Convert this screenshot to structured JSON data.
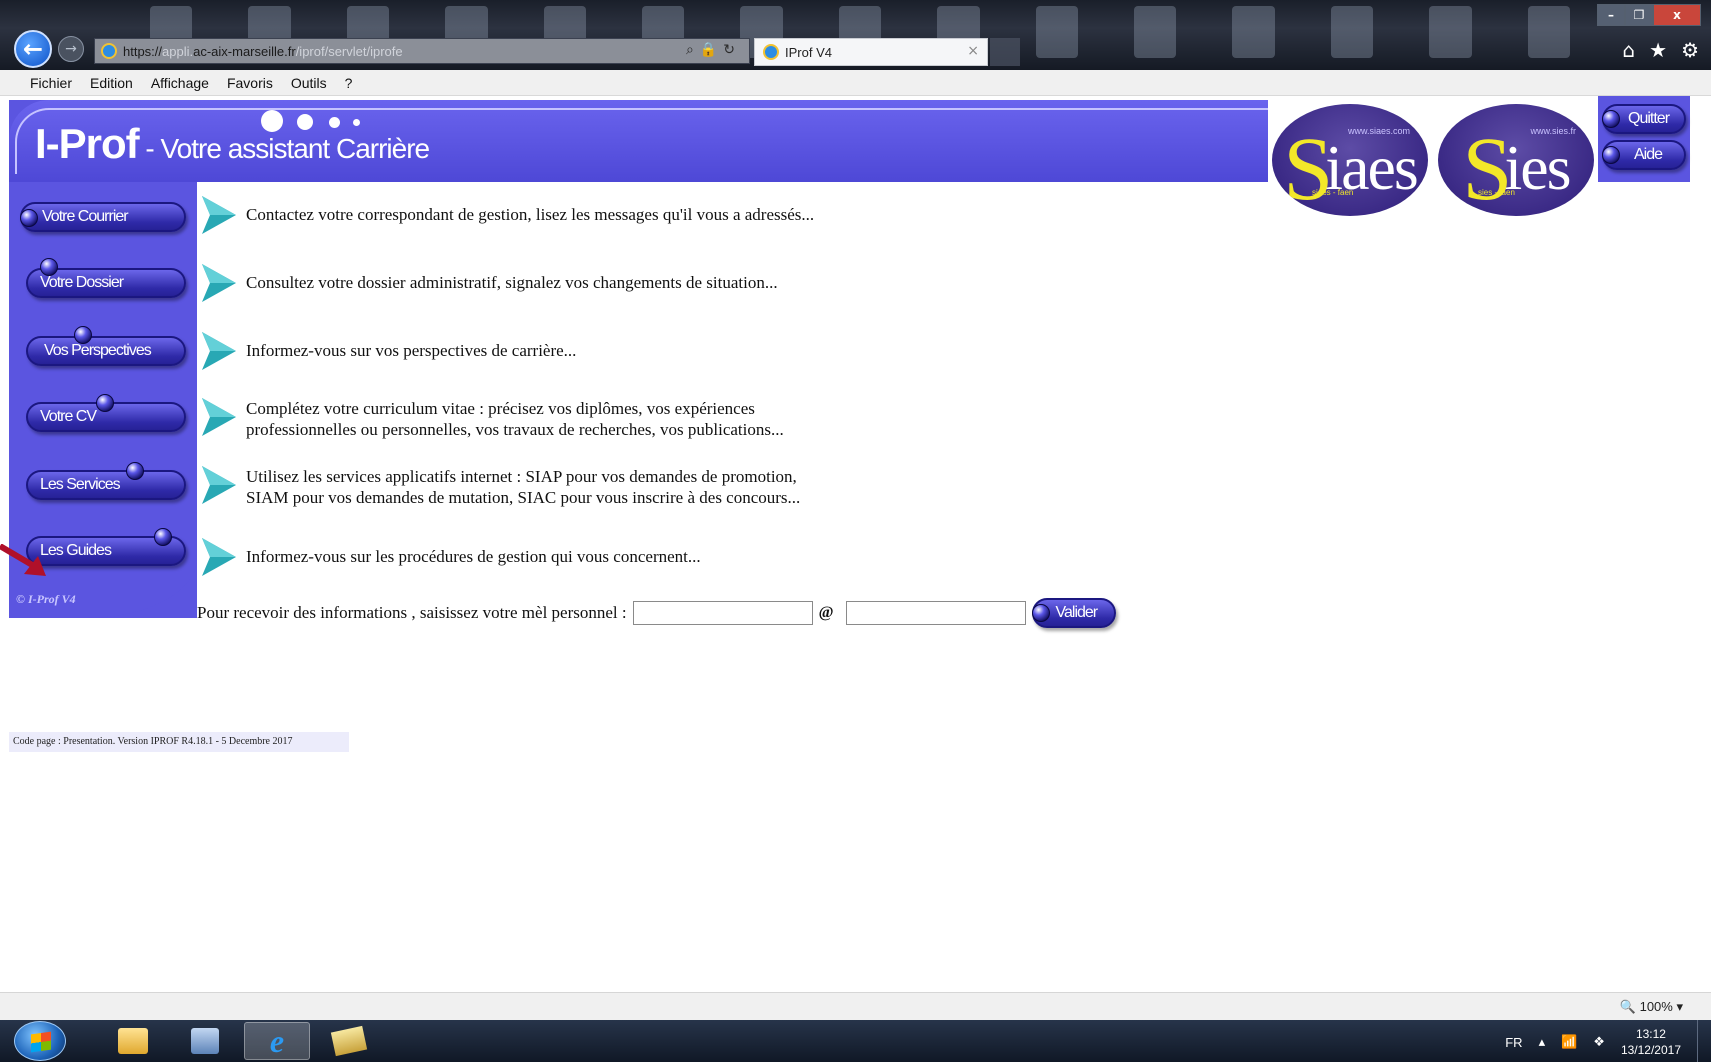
{
  "browser": {
    "url_host_prefix": "https://",
    "url_gray1": "appli.",
    "url_host": "ac-aix-marseille.fr",
    "url_path": "/iprof/servlet/iprofe",
    "tab_title": "IProf V4",
    "tab_close": "×",
    "window_buttons": {
      "minimize": "–",
      "maximize": "❐",
      "close": "x"
    },
    "icons": [
      "home-icon",
      "star-icon",
      "gear-icon"
    ]
  },
  "menu": {
    "items": [
      {
        "label": "Fichier"
      },
      {
        "label": "Edition"
      },
      {
        "label": "Affichage"
      },
      {
        "label": "Favoris"
      },
      {
        "label": "Outils"
      },
      {
        "label": "?"
      }
    ]
  },
  "banner": {
    "title_bold": "I-Prof",
    "title_rest": " - Votre assistant Carrière"
  },
  "logos": [
    {
      "word_first": "S",
      "word_rest": "iaes",
      "site": "www.siaes.com",
      "tag": "siaes - faen"
    },
    {
      "word_first": "S",
      "word_rest": "ies",
      "site": "www.sies.fr",
      "tag": "sies - faen"
    }
  ],
  "top_buttons": {
    "quit": "Quitter",
    "help": "Aide"
  },
  "nav": {
    "items": [
      {
        "label": "Votre Courrier",
        "description": "Contactez votre correspondant de gestion, lisez les messages qu'il vous a adressés..."
      },
      {
        "label": "Votre Dossier",
        "description": "Consultez votre dossier administratif, signalez vos changements de situation..."
      },
      {
        "label": "Vos Perspectives",
        "description": "Informez-vous sur vos perspectives de carrière..."
      },
      {
        "label": "Votre CV",
        "description_line1": "Complétez votre curriculum vitae : précisez vos diplômes, vos expériences",
        "description_line2": "professionnelles ou personnelles, vos travaux de recherches, vos publications..."
      },
      {
        "label": "Les Services",
        "description_line1": "Utilisez les services applicatifs internet : SIAP pour vos demandes de promotion,",
        "description_line2": "SIAM pour vos demandes de mutation, SIAC pour vous inscrire à des concours..."
      },
      {
        "label": "Les Guides",
        "description": "Informez-vous sur les procédures de gestion qui vous concernent..."
      }
    ],
    "copyright": "© I-Prof  V4"
  },
  "email": {
    "prompt": "Pour recevoir des informations , saisissez votre mèl personnel :",
    "local_value": "",
    "at": "@",
    "domain_value": "",
    "submit": "Valider"
  },
  "footer": {
    "code_page": "Code page : Presentation. Version IPROF R4.18.1 - 5 Decembre 2017"
  },
  "statusbar": {
    "zoom": "100%"
  },
  "taskbar": {
    "lang": "FR",
    "time": "13:12",
    "date": "13/12/2017"
  },
  "colors": {
    "banner": "#5b55e0",
    "pill": "#2f2aa8",
    "arrow": "#28a8b4",
    "annotation_arrow": "#b0102a"
  }
}
